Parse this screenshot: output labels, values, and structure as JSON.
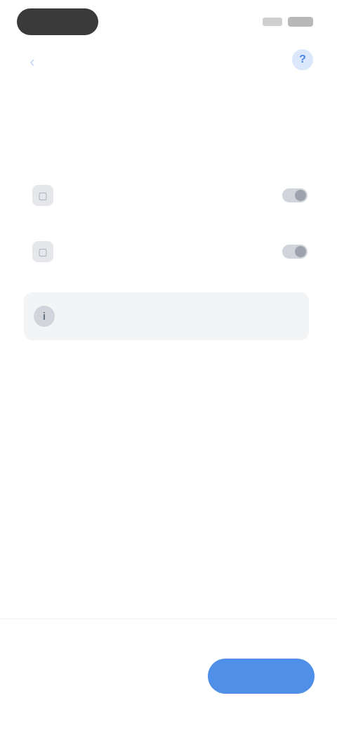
{
  "header": {
    "back_icon": "back-arrow-icon",
    "title": "",
    "subtitle": "",
    "help_icon": "help-icon"
  },
  "breadcrumb": {
    "steps": [
      "",
      "",
      "",
      ""
    ]
  },
  "section": {
    "label": ""
  },
  "options": [
    {
      "icon": "option-icon",
      "label": "",
      "value": ""
    },
    {
      "icon": "option-icon",
      "label": "",
      "value": ""
    }
  ],
  "info_card": {
    "icon": "info-icon",
    "text": ""
  },
  "link": {
    "text": ""
  },
  "footer": {
    "label": "",
    "value": "",
    "primary_button_label": ""
  },
  "colors": {
    "accent": "#4f8fe8",
    "link": "#8ab0ee",
    "muted": "#9ca3af"
  }
}
